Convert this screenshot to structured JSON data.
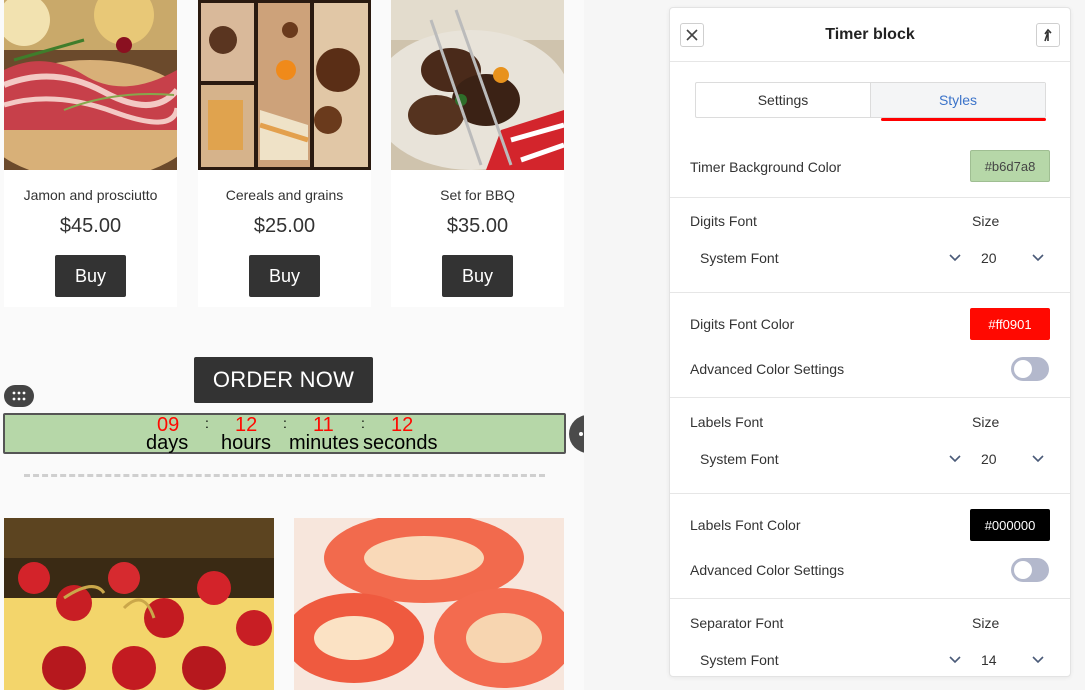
{
  "products": [
    {
      "name": "Jamon and prosciutto",
      "price": "$45.00",
      "buy_label": "Buy"
    },
    {
      "name": "Cereals and grains",
      "price": "$25.00",
      "buy_label": "Buy"
    },
    {
      "name": "Set for BBQ",
      "price": "$35.00",
      "buy_label": "Buy"
    }
  ],
  "order_button": "ORDER NOW",
  "timer": {
    "digits": {
      "days": "09",
      "hours": "12",
      "minutes": "11",
      "seconds": "12"
    },
    "separator": ":",
    "labels": {
      "days": "days",
      "hours": "hours",
      "minutes": "minutes",
      "seconds": "seconds"
    },
    "background_color": "#b6d7a8",
    "digits_color": "#ff0901",
    "labels_color": "#000000"
  },
  "panel": {
    "title": "Timer block",
    "tabs": [
      {
        "label": "Settings",
        "active": false
      },
      {
        "label": "Styles",
        "active": true
      }
    ],
    "timer_bg": {
      "label": "Timer Background Color",
      "value": "#b6d7a8"
    },
    "digits_font": {
      "label": "Digits Font",
      "size_label": "Size",
      "font": "System Font",
      "size": "20"
    },
    "digits_color": {
      "label": "Digits Font Color",
      "value": "#ff0901",
      "advanced_label": "Advanced Color Settings",
      "advanced_on": false
    },
    "labels_font": {
      "label": "Labels Font",
      "size_label": "Size",
      "font": "System Font",
      "size": "20"
    },
    "labels_color": {
      "label": "Labels Font Color",
      "value": "#000000",
      "advanced_label": "Advanced Color Settings",
      "advanced_on": false
    },
    "separator_font": {
      "label": "Separator Font",
      "size_label": "Size",
      "font": "System Font",
      "size": "14"
    }
  },
  "colors": {
    "accent_tab": "#3b73c9",
    "tab_underline": "#ff0000",
    "button_dark": "#333333",
    "toggle_off": "#b3b8cc"
  }
}
